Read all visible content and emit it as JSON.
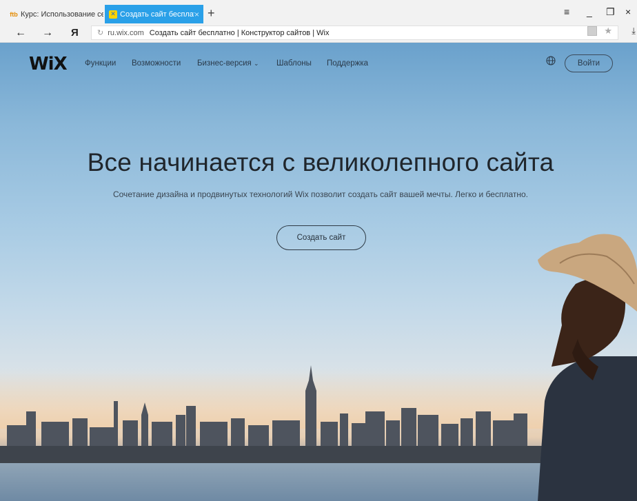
{
  "browser": {
    "tabs": [
      {
        "title": "Курс: Использование серв",
        "icon": "course-favicon"
      },
      {
        "title": "Создать сайт бесплатно",
        "icon": "wix-favicon",
        "active": true
      }
    ],
    "new_tab_symbol": "+",
    "url_domain": "ru.wix.com",
    "url_title": "Создать сайт бесплатно | Конструктор сайтов | Wix",
    "yandex_logo": "Я"
  },
  "site": {
    "logo": "WiX",
    "nav": [
      "Функции",
      "Возможности",
      "Бизнес-версия",
      "Шаблоны",
      "Поддержка"
    ],
    "login": "Войти",
    "headline": "Все начинается с великолепного сайта",
    "subheadline": "Сочетание дизайна и продвинутых технологий Wix позволит создать сайт вашей мечты. Легко и бесплатно.",
    "cta": "Создать сайт"
  },
  "colors": {
    "active_tab": "#2aa0e8",
    "text_dark": "#20262c"
  }
}
